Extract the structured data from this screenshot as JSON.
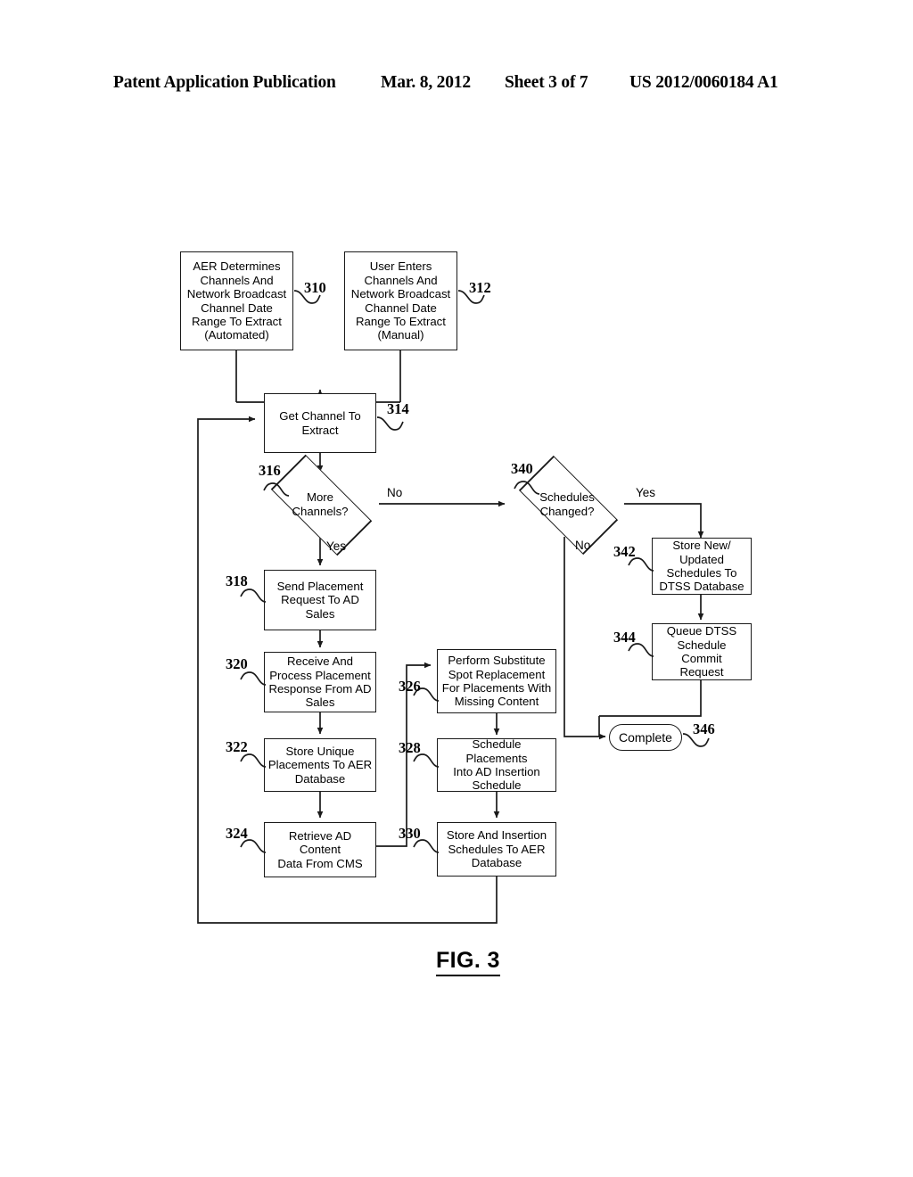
{
  "header": {
    "publication": "Patent Application Publication",
    "date": "Mar. 8, 2012",
    "sheet": "Sheet 3 of 7",
    "patent_number": "US 2012/0060184 A1"
  },
  "figure": {
    "caption": "FIG. 3",
    "nodes": {
      "n310": {
        "ref": "310",
        "text": "AER Determines\nChannels And\nNetwork Broadcast\nChannel Date\nRange To Extract\n(Automated)"
      },
      "n312": {
        "ref": "312",
        "text": "User Enters\nChannels And\nNetwork Broadcast\nChannel Date\nRange To Extract\n(Manual)"
      },
      "n314": {
        "ref": "314",
        "text": "Get Channel To\nExtract"
      },
      "n316": {
        "ref": "316",
        "text": "More\nChannels?"
      },
      "n318": {
        "ref": "318",
        "text": "Send Placement\nRequest To AD\nSales"
      },
      "n320": {
        "ref": "320",
        "text": "Receive And\nProcess Placement\nResponse From AD\nSales"
      },
      "n322": {
        "ref": "322",
        "text": "Store Unique\nPlacements To AER\nDatabase"
      },
      "n324": {
        "ref": "324",
        "text": "Retrieve AD Content\nData From CMS"
      },
      "n326": {
        "ref": "326",
        "text": "Perform Substitute\nSpot Replacement\nFor Placements With\nMissing Content"
      },
      "n328": {
        "ref": "328",
        "text": "Schedule Placements\nInto AD Insertion\nSchedule"
      },
      "n330": {
        "ref": "330",
        "text": "Store And Insertion\nSchedules To AER\nDatabase"
      },
      "n340": {
        "ref": "340",
        "text": "Schedules\nChanged?"
      },
      "n342": {
        "ref": "342",
        "text": "Store New/\nUpdated\nSchedules To\nDTSS Database"
      },
      "n344": {
        "ref": "344",
        "text": "Queue DTSS\nSchedule Commit\nRequest"
      },
      "n346": {
        "ref": "346",
        "text": "Complete"
      }
    },
    "edge_labels": {
      "more_channels_no": "No",
      "more_channels_yes": "Yes",
      "schedules_changed_yes": "Yes",
      "schedules_changed_no": "No"
    }
  }
}
